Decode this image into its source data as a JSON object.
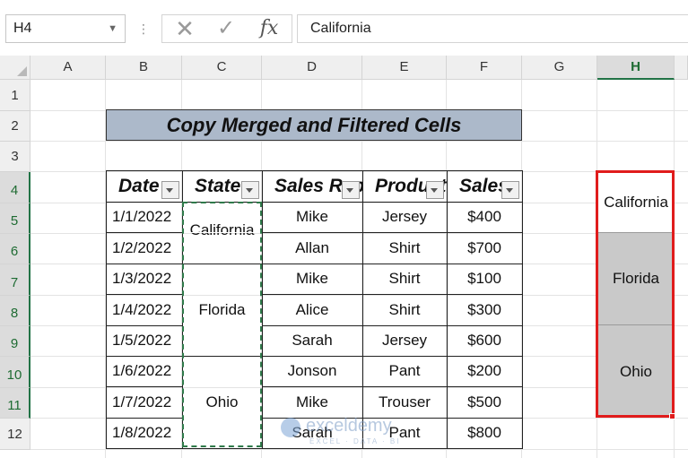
{
  "formula_bar": {
    "name_box": "H4",
    "dots": "⋮",
    "cancel_glyph": "✕",
    "enter_glyph": "✓",
    "fx_label": "fx",
    "formula": "California"
  },
  "columns": [
    "A",
    "B",
    "C",
    "D",
    "E",
    "F",
    "G",
    "H"
  ],
  "selected_column": "H",
  "rows": [
    "1",
    "2",
    "3",
    "4",
    "5",
    "6",
    "7",
    "8",
    "9",
    "10",
    "11",
    "12"
  ],
  "selected_rows": [
    "4",
    "5",
    "6",
    "7",
    "8",
    "9",
    "10",
    "11"
  ],
  "title": "Copy Merged and Filtered Cells",
  "table": {
    "headers": [
      "Date",
      "State",
      "Sales Rep",
      "Product",
      "Sales"
    ],
    "dates": [
      "1/1/2022",
      "1/2/2022",
      "1/3/2022",
      "1/4/2022",
      "1/5/2022",
      "1/6/2022",
      "1/7/2022",
      "1/8/2022"
    ],
    "states": [
      "California",
      "Florida",
      "Ohio"
    ],
    "reps": [
      "Mike",
      "Allan",
      "Mike",
      "Alice",
      "Sarah",
      "Jonson",
      "Mike",
      "Sarah"
    ],
    "products": [
      "Jersey",
      "Shirt",
      "Shirt",
      "Shirt",
      "Jersey",
      "Pant",
      "Trouser",
      "Pant"
    ],
    "sales": [
      "$400",
      "$700",
      "$100",
      "$300",
      "$600",
      "$200",
      "$500",
      "$800"
    ]
  },
  "pasted": [
    "California",
    "Florida",
    "Ohio"
  ],
  "colors": {
    "title_fill": "#acb9ca",
    "paste_fill": "#c9c9c9",
    "selection_border": "#e01c1c",
    "excel_green": "#217346"
  },
  "watermark": {
    "name": "exceldemy",
    "tagline": "EXCEL · DATA · BI"
  }
}
